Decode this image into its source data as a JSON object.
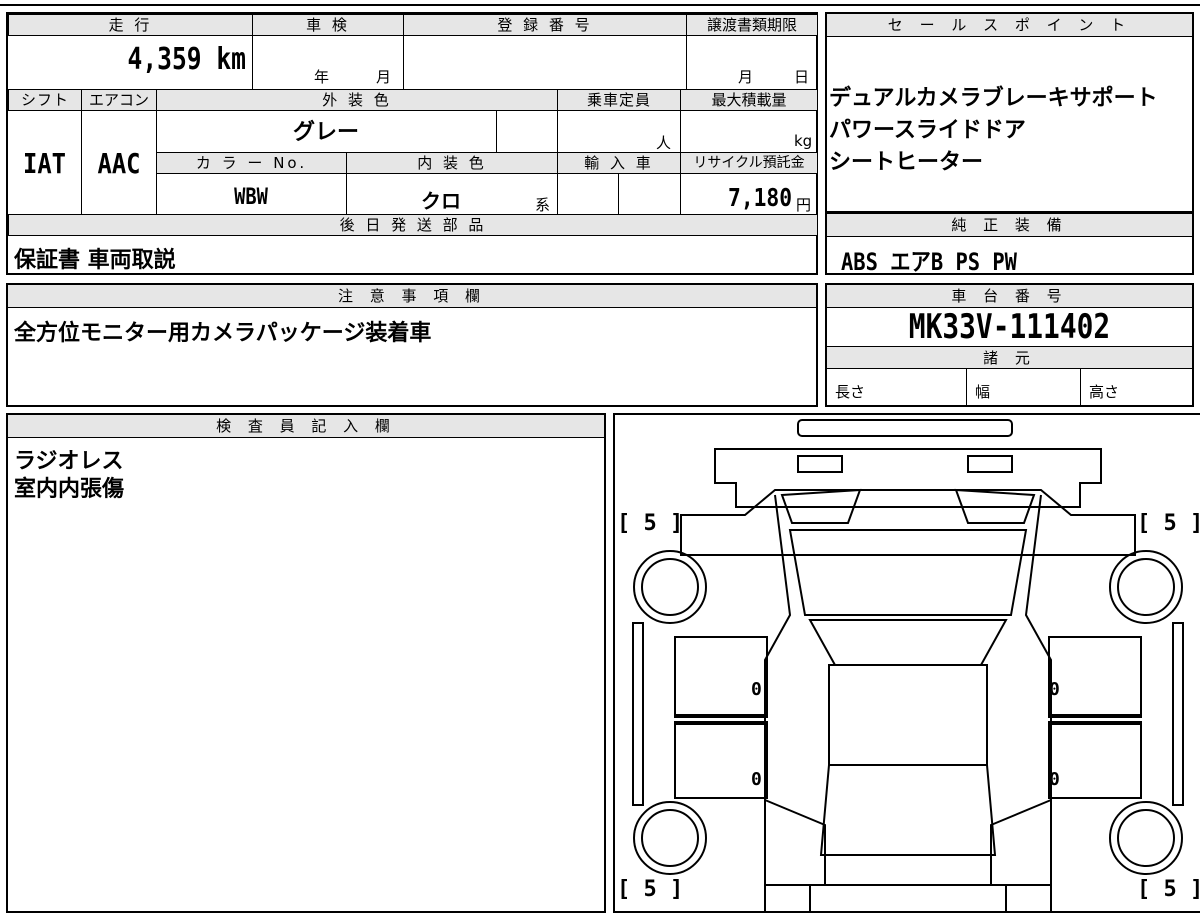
{
  "top": {
    "mileage_label": "走 行",
    "mileage_value": "4,359 km",
    "inspection_label": "車 検",
    "inspection_year_unit": "年",
    "inspection_month_unit": "月",
    "registration_label": "登 録 番 号",
    "transfer_deadline_label": "譲渡書類期限",
    "transfer_month_unit": "月",
    "transfer_day_unit": "日",
    "shift_label": "シフト",
    "shift_value": "IAT",
    "aircon_label": "エアコン",
    "aircon_value": "AAC",
    "exterior_color_label": "外 装 色",
    "exterior_color_value": "グレー",
    "capacity_label": "乗車定員",
    "capacity_unit": "人",
    "max_load_label": "最大積載量",
    "max_load_unit": "kg",
    "color_no_label": "カ ラ ー No.",
    "color_no_value": "WBW",
    "interior_color_label": "内 装 色",
    "interior_color_value": "クロ",
    "interior_color_unit": "系",
    "import_label": "輸 入 車",
    "recycle_label": "リサイクル預託金",
    "recycle_value": "7,180",
    "recycle_unit": "円",
    "later_parts_label": "後 日 発 送 部 品",
    "later_parts_value": "保証書 車両取説"
  },
  "sales_points": {
    "label": "セ ー ル ス ポ イ ン ト",
    "items": [
      "デュアルカメラブレーキサポート",
      "パワースライドドア",
      "シートヒーター"
    ]
  },
  "genuine_equipment": {
    "label": "純 正 装 備",
    "value": "ABS エアB PS PW"
  },
  "notes": {
    "label": "注 意 事 項 欄",
    "value": "全方位モニター用カメラパッケージ装着車"
  },
  "chassis": {
    "label": "車 台 番 号",
    "value": "MK33V-111402",
    "specs_label": "諸 元",
    "length_label": "長さ",
    "width_label": "幅",
    "height_label": "高さ"
  },
  "inspector": {
    "label": "検 査 員 記 入 欄",
    "lines": [
      "ラジオレス",
      "室内内張傷"
    ]
  },
  "diagram": {
    "tire_fl": "[ 5 ]",
    "tire_fr": "[ 5 ]",
    "tire_rl": "[ 5 ]",
    "tire_rr": "[ 5 ]",
    "mark_left_front": "0",
    "mark_right_front": "0",
    "mark_left_rear": "0",
    "mark_right_rear": "0"
  }
}
